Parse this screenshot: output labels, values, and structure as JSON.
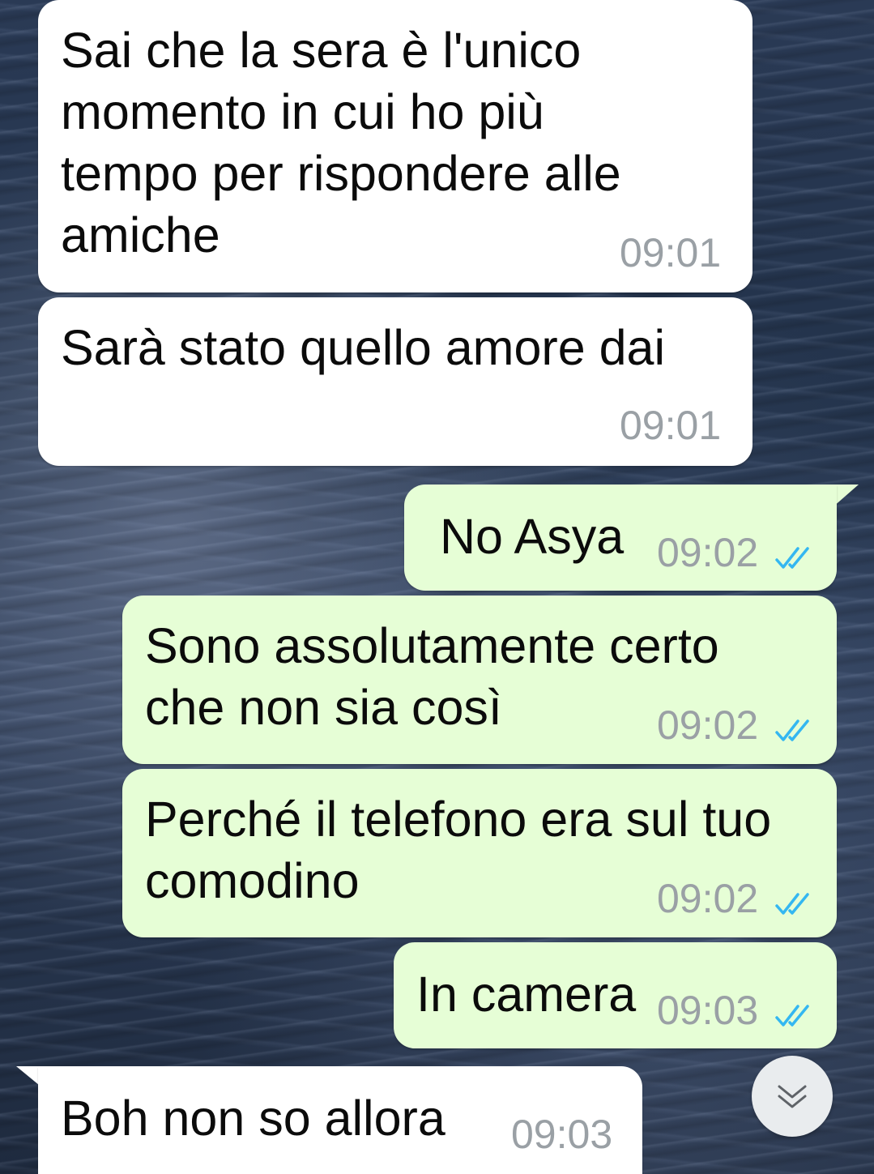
{
  "theme": {
    "incoming_bubble": "#ffffff",
    "outgoing_bubble": "#e6fed6",
    "tick_color": "#34b7f1",
    "time_color": "#9aa0a5"
  },
  "messages": [
    {
      "direction": "incoming",
      "text": "Sai che la sera è l'unico\nmomento in cui ho più\ntempo per rispondere alle\namiche",
      "time": "09:01"
    },
    {
      "direction": "incoming",
      "text": "Sarà stato quello amore dai",
      "time": "09:01"
    },
    {
      "direction": "outgoing",
      "text": "No Asya",
      "time": "09:02",
      "status": "read"
    },
    {
      "direction": "outgoing",
      "text": "Sono assolutamente certo\nche non sia così",
      "time": "09:02",
      "status": "read"
    },
    {
      "direction": "outgoing",
      "text": "Perché il telefono era sul tuo\ncomodino",
      "time": "09:02",
      "status": "read"
    },
    {
      "direction": "outgoing",
      "text": "In camera",
      "time": "09:03",
      "status": "read"
    },
    {
      "direction": "incoming",
      "text": "Boh non so allora",
      "time": "09:03"
    }
  ],
  "scroll_button": {
    "icon": "double-chevron-down-icon"
  }
}
